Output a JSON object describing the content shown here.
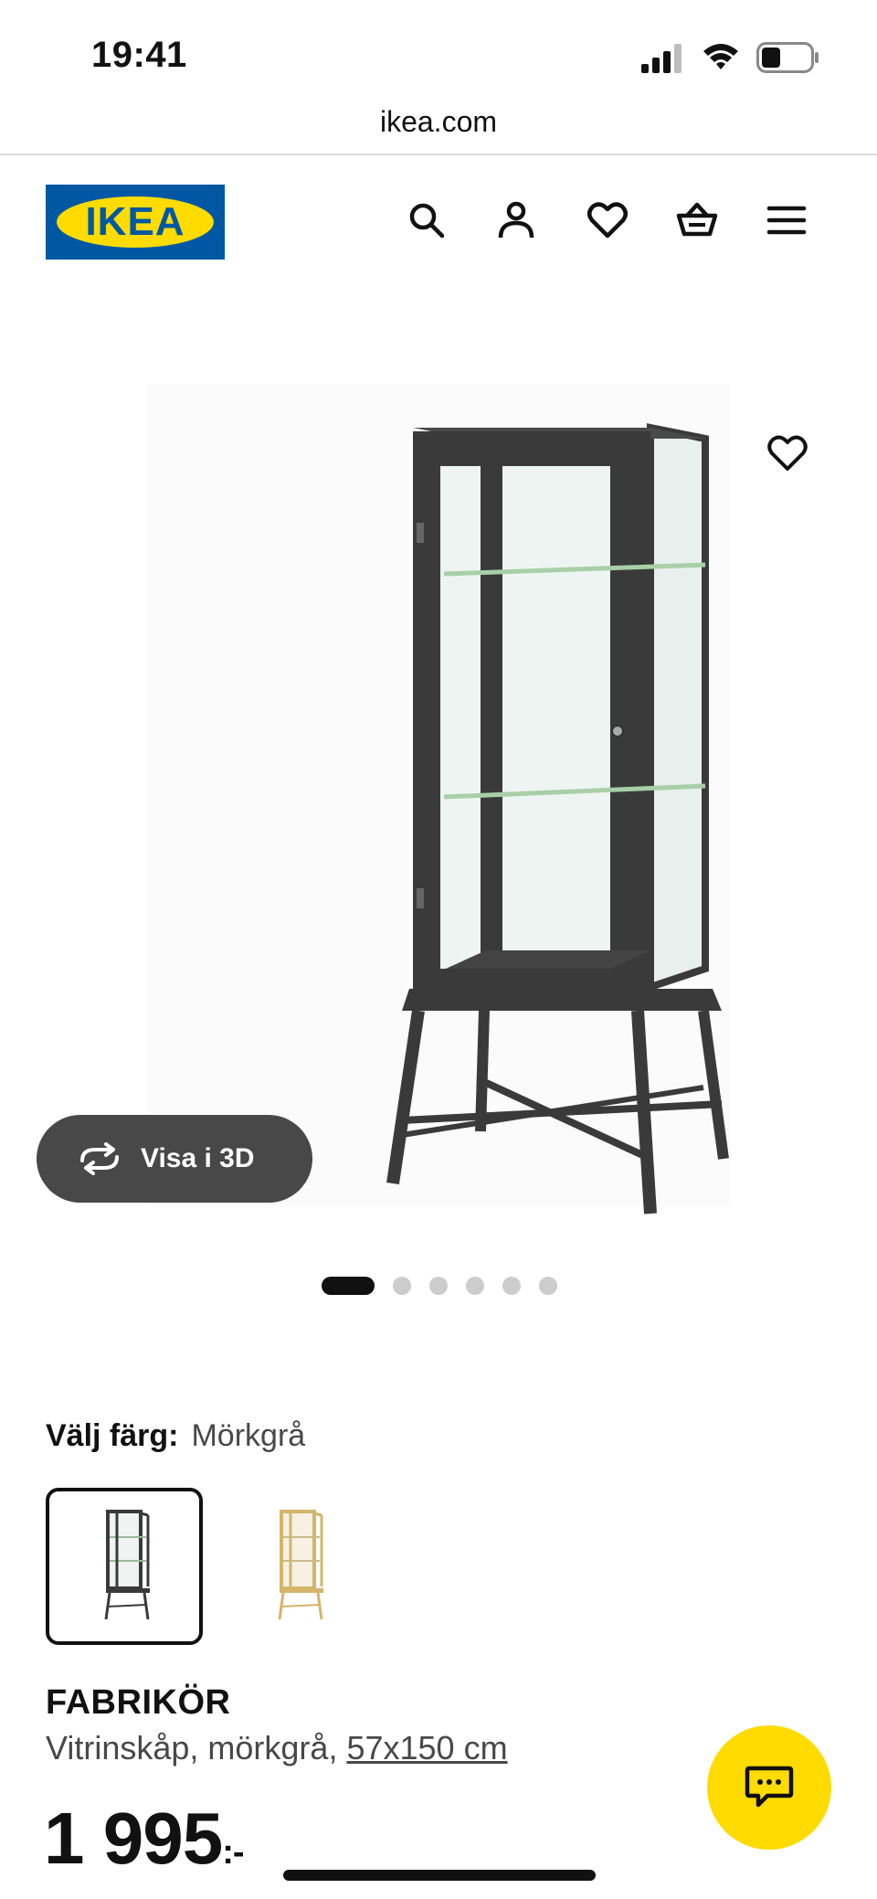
{
  "status_bar": {
    "time": "19:41"
  },
  "browser": {
    "address": "ikea.com"
  },
  "header": {
    "logo_text": "IKEA",
    "icons": [
      "search-icon",
      "user-icon",
      "heart-icon",
      "basket-icon",
      "menu-icon"
    ]
  },
  "gallery": {
    "view_3d_label": "Visa i 3D",
    "dots_total": 6,
    "dots_active_index": 0
  },
  "color_select": {
    "label": "Välj färg:",
    "selected_value": "Mörkgrå",
    "swatches": [
      "dark-grey",
      "beige"
    ]
  },
  "product": {
    "name": "FABRIKÖR",
    "description_prefix": "Vitrinskåp, mörkgrå, ",
    "size_link": "57x150 cm",
    "price_main": "1 995",
    "price_suffix": ":-"
  },
  "colors": {
    "ikea_blue": "#0058a3",
    "ikea_yellow": "#ffdb00",
    "cabinet_dark": "#3a3a3a",
    "cabinet_beige": "#d4b56a"
  }
}
